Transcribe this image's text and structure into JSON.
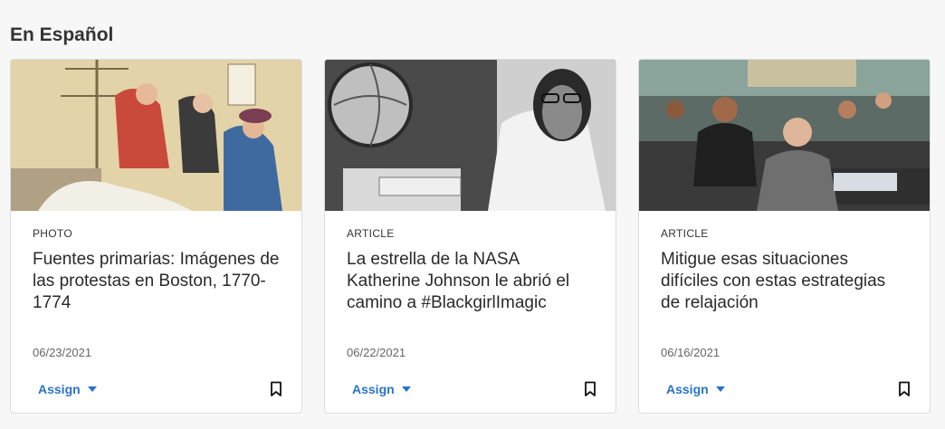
{
  "section": {
    "title": "En Español"
  },
  "cards": [
    {
      "type": "PHOTO",
      "title": "Fuentes primarias: Imágenes de las protestas en Boston, 1770-1774",
      "date": "06/23/2021",
      "assign_label": "Assign"
    },
    {
      "type": "ARTICLE",
      "title": "La estrella de la NASA Katherine Johnson le abrió el camino a #BlackgirlImagic",
      "date": "06/22/2021",
      "assign_label": "Assign"
    },
    {
      "type": "ARTICLE",
      "title": "Mitigue esas situaciones difíciles con estas estrategias de relajación",
      "date": "06/16/2021",
      "assign_label": "Assign"
    }
  ],
  "colors": {
    "accent": "#2a73c9"
  }
}
